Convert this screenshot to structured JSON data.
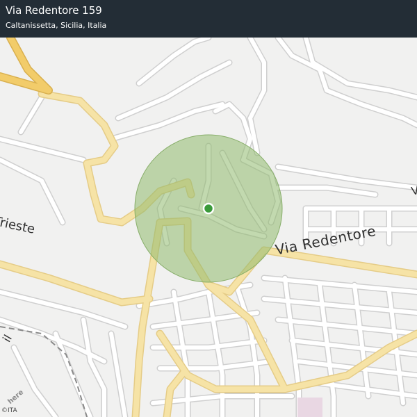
{
  "header": {
    "title": "Via Redentore 159",
    "subtitle": "Caltanissetta, Sicilia, Italia"
  },
  "map": {
    "labels": {
      "trieste": "Trieste",
      "redentore": "Via Redentore",
      "left_edge_partial": "il",
      "right_edge_partial": "V"
    },
    "colors": {
      "background": "#f1f1f0",
      "road_major": "#f6e3a6",
      "road_major_outline": "#e5cc87",
      "road_highway": "#f2cc6a",
      "road_minor": "#ffffff",
      "road_minor_outline": "#cfcfcf",
      "accuracy_circle": "#8fb96e",
      "location_marker": "#3a9a3a",
      "header_bg": "#232d36"
    }
  },
  "attribution": {
    "brand": "here",
    "copyright": "©ITA"
  }
}
